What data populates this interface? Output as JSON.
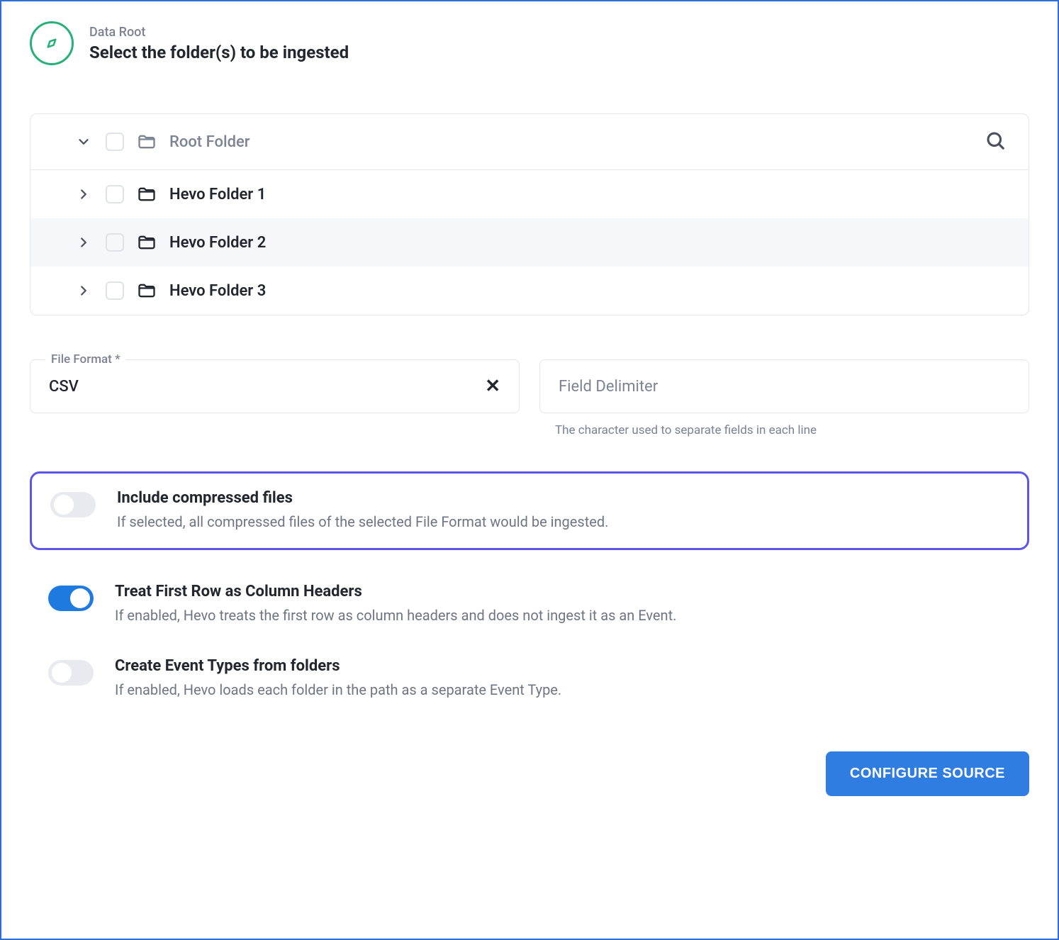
{
  "header": {
    "breadcrumb": "Data Root",
    "title": "Select the folder(s) to be ingested"
  },
  "folders": {
    "root_label": "Root Folder",
    "items": [
      {
        "label": "Hevo Folder 1"
      },
      {
        "label": "Hevo Folder 2"
      },
      {
        "label": "Hevo Folder 3"
      }
    ]
  },
  "file_format": {
    "legend": "File Format *",
    "value": "CSV"
  },
  "delimiter": {
    "placeholder": "Field Delimiter",
    "caption": "The character used to separate fields in each line"
  },
  "toggles": {
    "compressed": {
      "title": "Include compressed files",
      "desc": "If selected, all compressed files of the selected File Format would be ingested.",
      "on": false,
      "highlighted": true
    },
    "first_row": {
      "title": "Treat First Row as Column Headers",
      "desc": "If enabled, Hevo treats the first row as column headers and does not ingest it as an Event.",
      "on": true
    },
    "event_types": {
      "title": "Create Event Types from folders",
      "desc": "If enabled, Hevo loads each folder in the path as a separate Event Type.",
      "on": false
    }
  },
  "footer": {
    "submit_label": "CONFIGURE SOURCE"
  }
}
